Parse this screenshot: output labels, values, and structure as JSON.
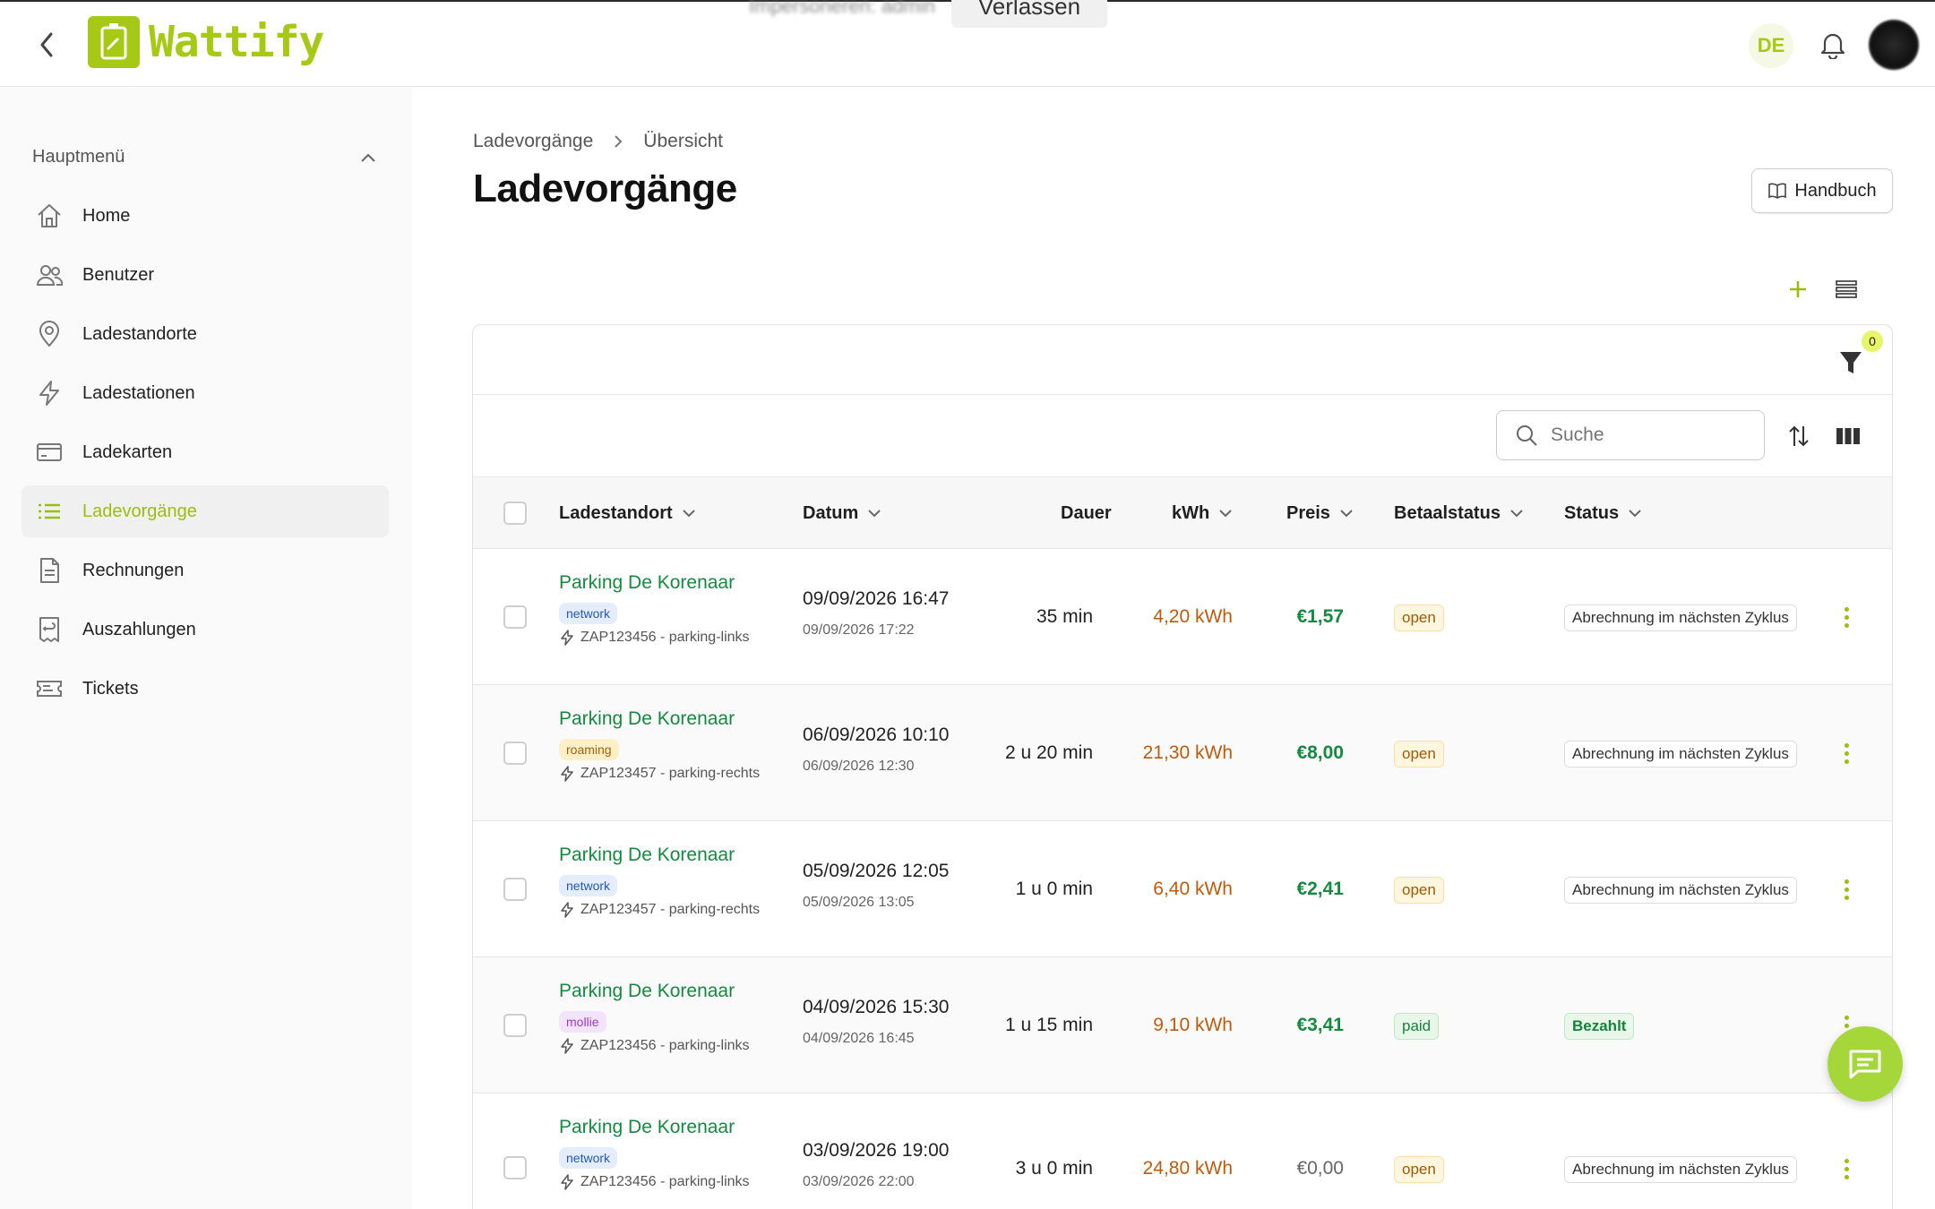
{
  "header": {
    "app_name": "Wattify",
    "banner_text": "Impersoneren: admin",
    "banner_leave": "Verlassen",
    "language": "DE"
  },
  "sidebar": {
    "menu_title": "Hauptmenü",
    "items": [
      {
        "label": "Home",
        "icon": "home-icon"
      },
      {
        "label": "Benutzer",
        "icon": "users-icon"
      },
      {
        "label": "Ladestandorte",
        "icon": "location-pin-icon"
      },
      {
        "label": "Ladestationen",
        "icon": "lightning-icon"
      },
      {
        "label": "Ladekarten",
        "icon": "card-icon"
      },
      {
        "label": "Ladevorgänge",
        "icon": "list-icon",
        "active": true
      },
      {
        "label": "Rechnungen",
        "icon": "document-icon"
      },
      {
        "label": "Auszahlungen",
        "icon": "receipt-return-icon"
      },
      {
        "label": "Tickets",
        "icon": "ticket-icon"
      }
    ]
  },
  "breadcrumb": [
    "Ladevorgänge",
    "Übersicht"
  ],
  "page": {
    "title": "Ladevorgänge",
    "manual_label": "Handbuch"
  },
  "filter": {
    "count": "0"
  },
  "search": {
    "placeholder": "Suche",
    "value": ""
  },
  "table": {
    "columns": [
      "Ladestandort",
      "Datum",
      "Dauer",
      "kWh",
      "Preis",
      "Betaalstatus",
      "Status"
    ],
    "rows": [
      {
        "location": "Parking De Korenaar",
        "tag": "network",
        "station": "ZAP123456 - parking-links",
        "start": "09/09/2026 16:47",
        "end": "09/09/2026 17:22",
        "duration": "35 min",
        "kwh": "4,20 kWh",
        "price": "€1,57",
        "pay_status": "open",
        "status": "Abrechnung im nächsten Zyklus"
      },
      {
        "location": "Parking De Korenaar",
        "tag": "roaming",
        "station": "ZAP123457 - parking-rechts",
        "start": "06/09/2026 10:10",
        "end": "06/09/2026 12:30",
        "duration": "2 u 20 min",
        "kwh": "21,30 kWh",
        "price": "€8,00",
        "pay_status": "open",
        "status": "Abrechnung im nächsten Zyklus"
      },
      {
        "location": "Parking De Korenaar",
        "tag": "network",
        "station": "ZAP123457 - parking-rechts",
        "start": "05/09/2026 12:05",
        "end": "05/09/2026 13:05",
        "duration": "1 u 0 min",
        "kwh": "6,40 kWh",
        "price": "€2,41",
        "pay_status": "open",
        "status": "Abrechnung im nächsten Zyklus"
      },
      {
        "location": "Parking De Korenaar",
        "tag": "mollie",
        "station": "ZAP123456 - parking-links",
        "start": "04/09/2026 15:30",
        "end": "04/09/2026 16:45",
        "duration": "1 u 15 min",
        "kwh": "9,10 kWh",
        "price": "€3,41",
        "pay_status": "paid",
        "status": "Bezahlt"
      },
      {
        "location": "Parking De Korenaar",
        "tag": "network",
        "station": "ZAP123456 - parking-links",
        "start": "03/09/2026 19:00",
        "end": "03/09/2026 22:00",
        "duration": "3 u 0 min",
        "kwh": "24,80 kWh",
        "price": "€0,00",
        "pay_status": "open",
        "status": "Abrechnung im nächsten Zyklus"
      }
    ]
  },
  "colors": {
    "brand": "#a5c914",
    "link_green": "#148a3e",
    "kwh_orange": "#c05a0d"
  }
}
